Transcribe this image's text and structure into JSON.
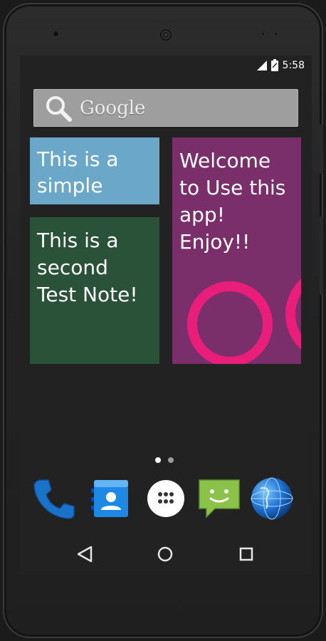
{
  "status_bar": {
    "time": "5:58",
    "icons": [
      "signal-icon",
      "battery-charging-icon"
    ]
  },
  "search": {
    "label": "Google",
    "icon": "search-icon"
  },
  "notes": [
    {
      "id": "note-1",
      "text": "This is a simple",
      "color": "#6aa7c9"
    },
    {
      "id": "note-2",
      "text": "This is a second Test Note!",
      "color": "#2a5238"
    },
    {
      "id": "note-3",
      "text": "Welcome to Use this app! Enjoy!!",
      "color": "#7a2f6b"
    }
  ],
  "page_indicator": {
    "total": 2,
    "current": 1
  },
  "dock": [
    {
      "name": "phone-app-icon",
      "label": ""
    },
    {
      "name": "contacts-app-icon",
      "label": ""
    },
    {
      "name": "app-drawer-icon",
      "label": ""
    },
    {
      "name": "messaging-app-icon",
      "label": ""
    },
    {
      "name": "browser-app-icon",
      "label": ""
    }
  ],
  "nav": [
    "back-icon",
    "home-icon",
    "recents-icon"
  ],
  "colors": {
    "accent_pink": "#e81e7a",
    "screen_bg": "#222222"
  }
}
